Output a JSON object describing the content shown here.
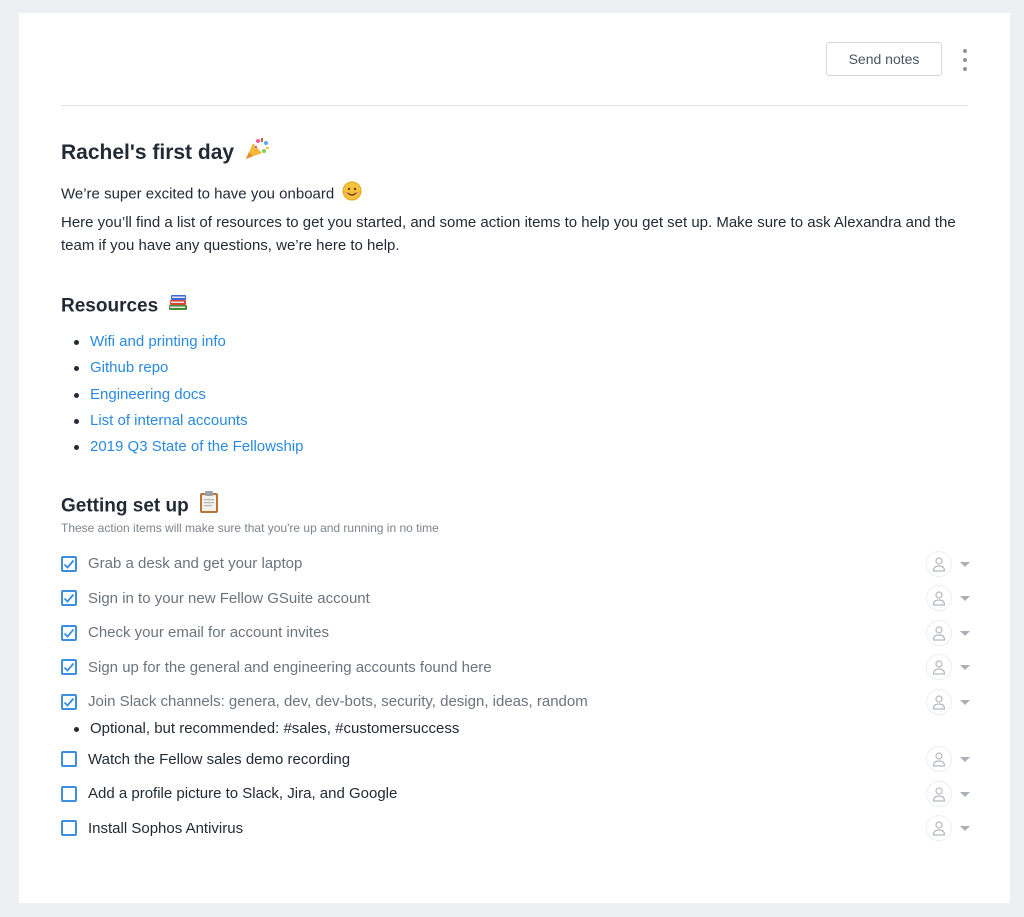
{
  "header": {
    "send_label": "Send notes"
  },
  "note": {
    "title": "Rachel's first day",
    "intro_1": "We’re super excited to have you onboard",
    "intro_2": "Here you’ll find a list of resources to get you started, and some action items to help you get set up. Make sure to ask Alexandra and the team if you have any questions, we’re here to help."
  },
  "resources": {
    "heading": "Resources",
    "links": [
      "Wifi and printing info",
      "Github repo",
      "Engineering docs",
      "List of internal accounts",
      "2019 Q3 State of the Fellowship"
    ]
  },
  "setup": {
    "heading": "Getting set up",
    "subtitle": "These action items will make sure that you're up and running in no time",
    "tasks": [
      {
        "label": "Grab a desk and get your laptop",
        "done": true
      },
      {
        "label": "Sign in to your new Fellow GSuite account",
        "done": true
      },
      {
        "label": "Check your email for account invites",
        "done": true
      },
      {
        "label": "Sign up for the general and engineering accounts found here",
        "done": true
      },
      {
        "label": "Join Slack channels: genera, dev, dev-bots, security, design, ideas, random",
        "done": true
      },
      {
        "label": "Watch the Fellow sales demo recording",
        "done": false
      },
      {
        "label": "Add a profile picture to Slack, Jira, and Google",
        "done": false
      },
      {
        "label": "Install Sophos Antivirus",
        "done": false
      }
    ],
    "sub_bullet": "Optional, but recommended: #sales, #customersuccess"
  },
  "colors": {
    "link": "#2a8ae0",
    "checkbox": "#3b8ee0",
    "background": "#eeeff2"
  },
  "icons": [
    "party-popper-emoji",
    "smile-emoji",
    "books-emoji",
    "clipboard-emoji",
    "check-icon",
    "person-icon",
    "caret-down-icon",
    "kebab-menu-icon"
  ]
}
